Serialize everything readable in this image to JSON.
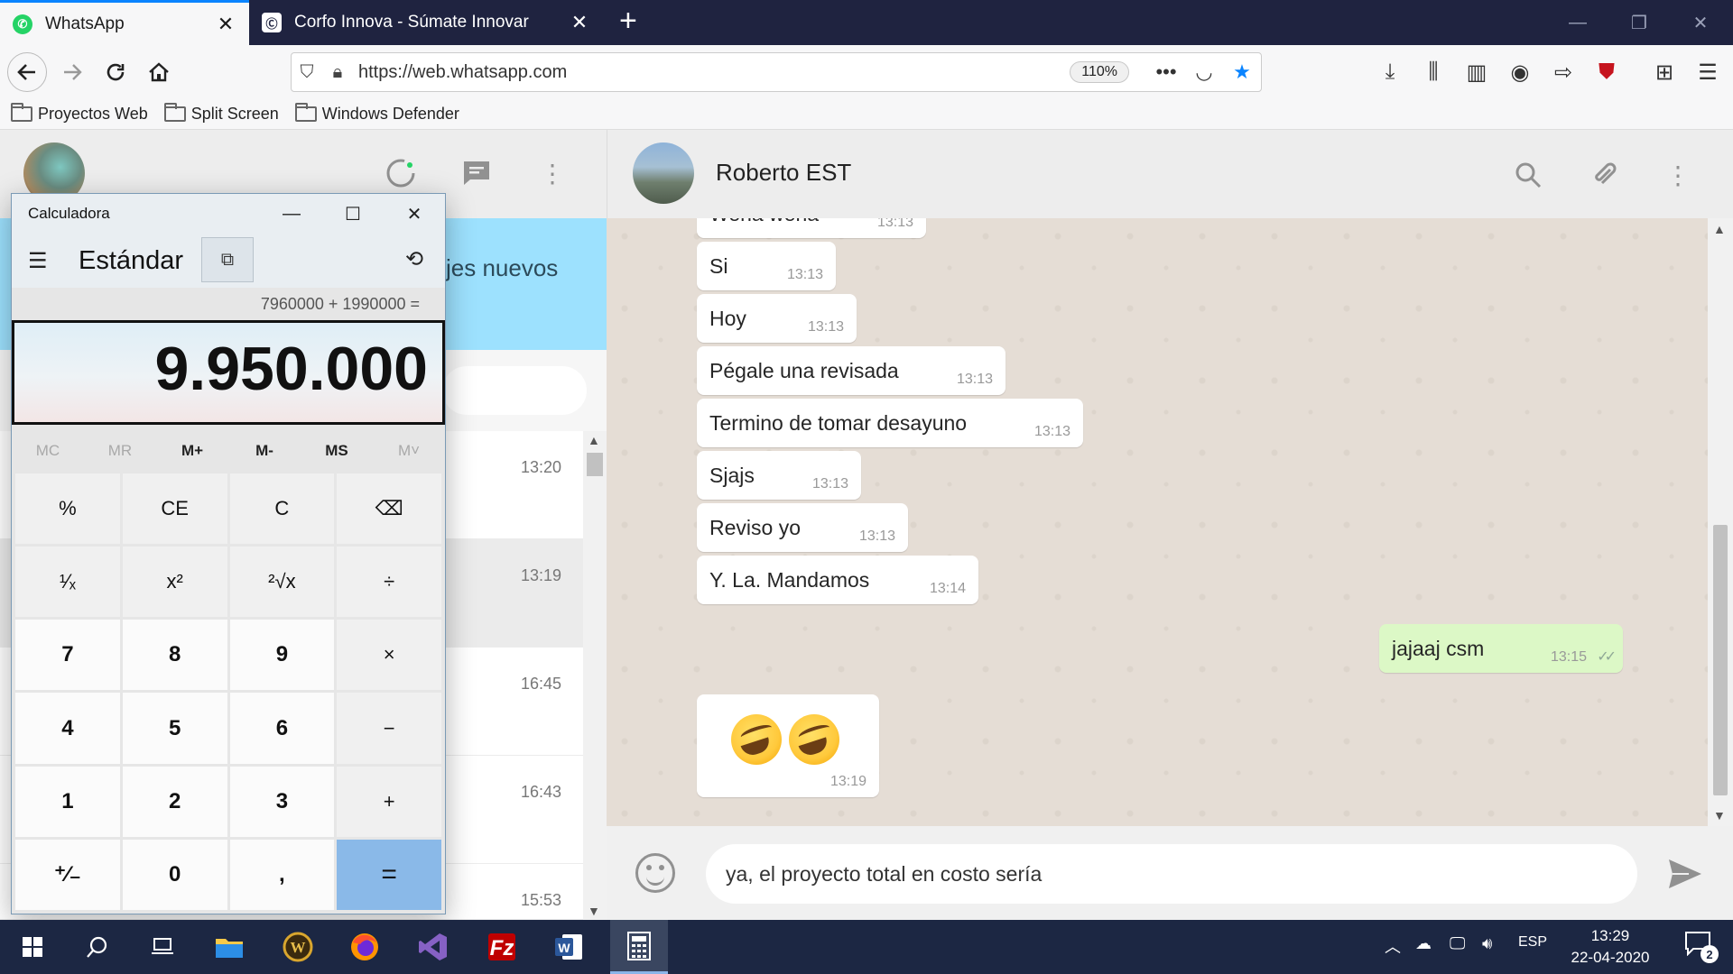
{
  "browser": {
    "tabs": [
      {
        "label": "WhatsApp",
        "icon": "whatsapp-icon",
        "active": true
      },
      {
        "label": "Corfo Innova - Súmate Innovar",
        "icon": "corfo-icon",
        "active": false
      }
    ],
    "url": "https://web.whatsapp.com",
    "zoom": "110%",
    "bookmarks": [
      "Proyectos Web",
      "Split Screen",
      "Windows Defender"
    ]
  },
  "whatsapp": {
    "notification_text": "jes nuevos",
    "chat_list_times": [
      "13:20",
      "13:19",
      "16:45",
      "16:43",
      "15:53"
    ],
    "contact_name": "Roberto EST",
    "messages": [
      {
        "text": "Wena wena",
        "time": "13:13",
        "direction": "in"
      },
      {
        "text": "Si",
        "time": "13:13",
        "direction": "in"
      },
      {
        "text": "Hoy",
        "time": "13:13",
        "direction": "in"
      },
      {
        "text": "Pégale una revisada",
        "time": "13:13",
        "direction": "in"
      },
      {
        "text": "Termino de tomar desayuno",
        "time": "13:13",
        "direction": "in"
      },
      {
        "text": "Sjajs",
        "time": "13:13",
        "direction": "in"
      },
      {
        "text": "Reviso yo",
        "time": "13:13",
        "direction": "in"
      },
      {
        "text": "Y. La. Mandamos",
        "time": "13:14",
        "direction": "in"
      },
      {
        "text": "jajaaj csm",
        "time": "13:15",
        "direction": "out",
        "status": "read-ticks"
      },
      {
        "text": "",
        "emoji": [
          "rolling-on-floor-laughing",
          "rolling-on-floor-laughing"
        ],
        "time": "13:19",
        "direction": "in"
      }
    ],
    "composer_text": "ya, el proyecto total en costo sería"
  },
  "calculator": {
    "window_title": "Calculadora",
    "mode": "Estándar",
    "expression": "7960000 + 1990000 =",
    "display": "9.950.000",
    "memory_buttons": [
      {
        "label": "MC",
        "enabled": false
      },
      {
        "label": "MR",
        "enabled": false
      },
      {
        "label": "M+",
        "enabled": true
      },
      {
        "label": "M-",
        "enabled": true
      },
      {
        "label": "MS",
        "enabled": true
      },
      {
        "label": "M˅",
        "enabled": false
      }
    ],
    "keys": [
      {
        "label": "%",
        "name": "percent-key",
        "type": "op"
      },
      {
        "label": "CE",
        "name": "clear-entry-key",
        "type": "op"
      },
      {
        "label": "C",
        "name": "clear-key",
        "type": "op"
      },
      {
        "label": "⌫",
        "name": "backspace-key",
        "type": "op"
      },
      {
        "label": "¹⁄ₓ",
        "name": "reciprocal-key",
        "type": "op"
      },
      {
        "label": "x²",
        "name": "square-key",
        "type": "op"
      },
      {
        "label": "²√x",
        "name": "sqrt-key",
        "type": "op"
      },
      {
        "label": "÷",
        "name": "divide-key",
        "type": "op"
      },
      {
        "label": "7",
        "name": "digit-7-key",
        "type": "num"
      },
      {
        "label": "8",
        "name": "digit-8-key",
        "type": "num"
      },
      {
        "label": "9",
        "name": "digit-9-key",
        "type": "num"
      },
      {
        "label": "×",
        "name": "multiply-key",
        "type": "op"
      },
      {
        "label": "4",
        "name": "digit-4-key",
        "type": "num"
      },
      {
        "label": "5",
        "name": "digit-5-key",
        "type": "num"
      },
      {
        "label": "6",
        "name": "digit-6-key",
        "type": "num"
      },
      {
        "label": "−",
        "name": "subtract-key",
        "type": "op"
      },
      {
        "label": "1",
        "name": "digit-1-key",
        "type": "num"
      },
      {
        "label": "2",
        "name": "digit-2-key",
        "type": "num"
      },
      {
        "label": "3",
        "name": "digit-3-key",
        "type": "num"
      },
      {
        "label": "+",
        "name": "add-key",
        "type": "op"
      },
      {
        "label": "⁺∕₋",
        "name": "negate-key",
        "type": "num"
      },
      {
        "label": "0",
        "name": "digit-0-key",
        "type": "num"
      },
      {
        "label": ",",
        "name": "decimal-key",
        "type": "num"
      },
      {
        "label": "=",
        "name": "equals-key",
        "type": "eq"
      }
    ]
  },
  "taskbar": {
    "apps": [
      "start-icon",
      "search-icon",
      "task-view-icon",
      "file-explorer-icon",
      "world-of-warcraft-icon",
      "firefox-icon",
      "visual-studio-icon",
      "filezilla-icon",
      "word-icon",
      "calculator-icon"
    ],
    "language": "ESP",
    "time": "13:29",
    "date": "22-04-2020",
    "notifications": "2"
  },
  "colors": {
    "tabbar": "#1f2340",
    "whatsapp_banner": "#9de1fe",
    "chat_background": "#e5ddd5",
    "outgoing_bubble": "#dcf8c6",
    "equals_key": "#8ab9e8",
    "taskbar": "#1c2743"
  }
}
